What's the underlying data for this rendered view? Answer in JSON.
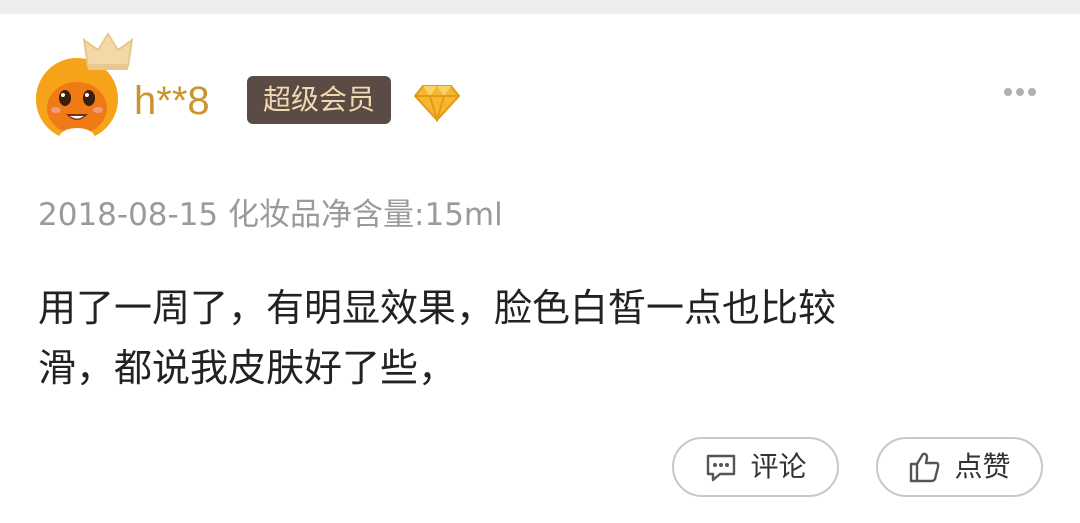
{
  "user": {
    "name": "h**8",
    "badge": "超级会员"
  },
  "review": {
    "date": "2018-08-15",
    "spec": "化妆品净含量:15ml",
    "text_line1": "用了一周了，有明显效果，脸色白皙一点也比较",
    "text_line2": "滑，都说我皮肤好了些，"
  },
  "actions": {
    "comment_label": "评论",
    "like_label": "点赞"
  },
  "icons": {
    "avatar": "orange-mascot-avatar",
    "crown": "crown-icon",
    "diamond": "diamond-icon",
    "more": "more-dots-icon",
    "comment": "comment-bubble-icon",
    "like": "thumbs-up-icon"
  },
  "colors": {
    "username": "#c9962e",
    "badge_bg": "#5a4b44",
    "badge_text": "#f0d9b2",
    "diamond": "#f5b731",
    "meta_text": "#9a9a9a",
    "body_text": "#222222"
  }
}
